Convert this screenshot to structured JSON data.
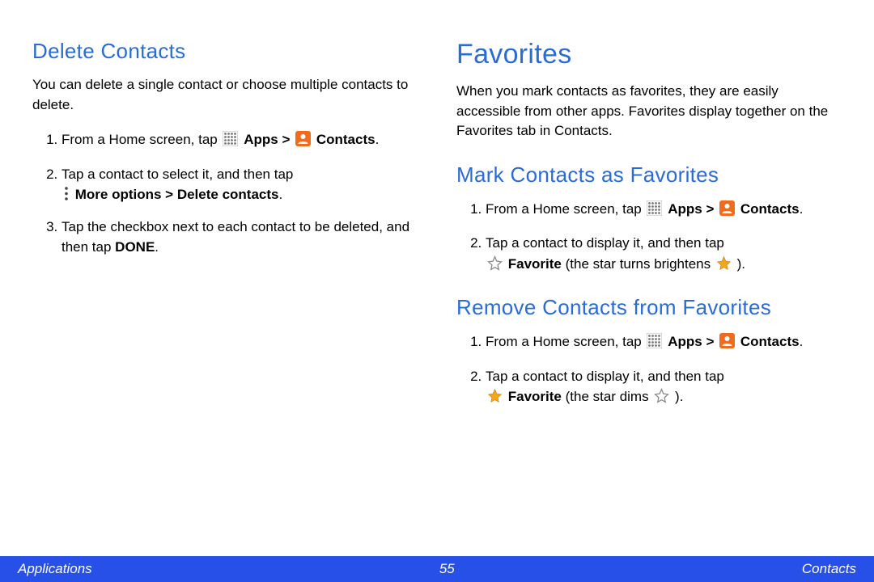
{
  "left": {
    "h2": "Delete Contacts",
    "intro": "You can delete a single contact or choose multiple contacts to delete.",
    "step1_a": "From a Home screen, tap ",
    "apps_label": "Apps",
    "gt": ">",
    "contacts_label": "Contacts",
    "step2_a": "Tap a contact to select it, and then tap ",
    "step2_b": "More options > Delete contacts",
    "step3_a": "Tap the checkbox next to each contact to be deleted, and then tap ",
    "done": "DONE"
  },
  "right": {
    "h1": "Favorites",
    "intro": "When you mark contacts as favorites, they are easily accessible from other apps. Favorites display together on the Favorites tab in Contacts.",
    "mark": {
      "h2": "Mark Contacts as Favorites",
      "step1_a": "From a Home screen, tap ",
      "step2_a": "Tap a contact to display it, and then tap ",
      "fav_label": "Favorite",
      "step2_b": " (the star turns brightens ",
      "step2_c": ")."
    },
    "remove": {
      "h2": "Remove Contacts from Favorites",
      "step1_a": "From a Home screen, tap ",
      "step2_a": "Tap a contact to display it, and then tap ",
      "fav_label": "Favorite",
      "step2_b": " (the star dims ",
      "step2_c": ")."
    }
  },
  "footer": {
    "left": "Applications",
    "page": "55",
    "right": "Contacts"
  },
  "period": "."
}
